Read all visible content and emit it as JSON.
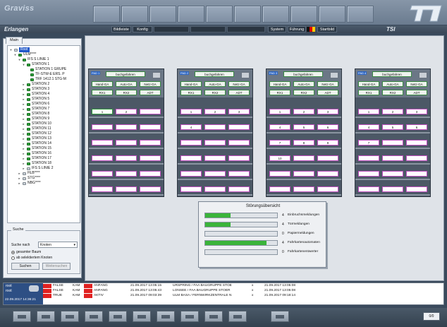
{
  "header": {
    "app_title": "Graviss",
    "location": "Erlangen",
    "brand": "TSI"
  },
  "nav": {
    "bildleiste": "Bildleiste",
    "konfig": "Konfig",
    "system": "System",
    "fuehrung": "Führung",
    "startbild": "Startbild"
  },
  "tabs": {
    "main": "Main"
  },
  "tree": {
    "root": "Root",
    "ulm": "ULM****",
    "ifs_linie_1": "IFS S LINIE 1",
    "station_1": "STATION 1",
    "station_1_grupe": "STATION 1 GRUPE",
    "tf_stw": "TF-STW-E ERS. P",
    "trf": "TRF 1412.1 STG-M",
    "stations": [
      "STATION 2",
      "STATION 3",
      "STATION 4",
      "STATION 5",
      "STATION 6",
      "STATION 7",
      "STATION 8",
      "STATION 9",
      "STATION 10",
      "STATION 11",
      "STATION 12",
      "STATION 13",
      "STATION 14",
      "STATION 15",
      "STATION 16",
      "STATION 17",
      "STATION 18"
    ],
    "ifs_linie_2": "IFS S LINIE 2",
    "hlb": "HLB****",
    "stg": "STG****",
    "nbg": "NBG****"
  },
  "search": {
    "title": "Suche",
    "label": "Suche nach",
    "selected": "Knoten",
    "radio_1": "gesamter Baum",
    "radio_2": "ab selektiertem Knoten",
    "btn_search": "Suchen",
    "btn_next": "Weitersuchen"
  },
  "racks": [
    {
      "hdr": "PAD 1",
      "title": "buchgefahren",
      "b1": "Hand-GA",
      "b2": "Auto-GA",
      "b3": "Netz-GA",
      "c1": "RX1",
      "c2": "RX2",
      "c3": "ADT",
      "slots": [
        [
          "1",
          "2",
          ""
        ],
        [
          "",
          "",
          ""
        ],
        [
          "",
          "",
          ""
        ],
        [
          "",
          "",
          ""
        ],
        [
          "",
          "",
          ""
        ],
        [
          "",
          "",
          ""
        ]
      ]
    },
    {
      "hdr": "PAD 2",
      "title": "buchgefahren",
      "b1": "Hand-GA",
      "b2": "Auto-GA",
      "b3": "Netz-GA",
      "c1": "RX1",
      "c2": "RX2",
      "c3": "ADT",
      "slots": [
        [
          "1",
          "2",
          "3"
        ],
        [
          "4",
          "",
          ""
        ],
        [
          "",
          "",
          ""
        ],
        [
          "",
          "",
          ""
        ],
        [
          "",
          "",
          ""
        ],
        [
          "",
          "",
          ""
        ]
      ]
    },
    {
      "hdr": "PAD 3",
      "title": "buchgefahren",
      "b1": "Hand-GA",
      "b2": "Auto-GA",
      "b3": "Netz-GA",
      "c1": "RX1",
      "c2": "RX2",
      "c3": "ADT",
      "slots": [
        [
          "1",
          "2",
          "3"
        ],
        [
          "4",
          "5",
          "6"
        ],
        [
          "7",
          "8",
          "9"
        ],
        [
          "10",
          "",
          ""
        ],
        [
          "",
          "",
          ""
        ],
        [
          "",
          "",
          ""
        ]
      ]
    },
    {
      "hdr": "PAD 4",
      "title": "buchgefahren",
      "b1": "Hand-GA",
      "b2": "Auto-GA",
      "b3": "Netz-GA",
      "c1": "RX1",
      "c2": "RX2",
      "c3": "ADT",
      "slots": [
        [
          "1",
          "2",
          "3"
        ],
        [
          "4",
          "5",
          "6"
        ],
        [
          "7",
          "",
          ""
        ],
        [
          "",
          "",
          ""
        ],
        [
          "",
          "",
          ""
        ],
        [
          "",
          "",
          ""
        ]
      ]
    }
  ],
  "summary": {
    "title": "Störungsübersicht",
    "rows": [
      {
        "value": "4",
        "label": "Einbruchsmeldungen",
        "fill": 0.35
      },
      {
        "value": "4",
        "label": "Türmeldungen",
        "fill": 0.35
      },
      {
        "value": "0",
        "label": "Papiermeldungen",
        "fill": 0
      },
      {
        "value": "4",
        "label": "Fahrkartenautomaten",
        "fill": 0.85
      },
      {
        "value": "0",
        "label": "Fahrkartenentwerter",
        "fill": 0
      }
    ]
  },
  "log": {
    "user": "root",
    "user2": "root",
    "datetime": "22.09.2017 14:36:21",
    "rows": [
      {
        "flag": "FALSE",
        "type": "KAM",
        "state": "ANFANG",
        "time": "21.09.2017 13:05:15",
        "text": "URSPRING / FAA BAUGRUPPE STOE",
        "x": "x",
        "time2": "21.09.2017 13:05:08"
      },
      {
        "flag": "FALSE",
        "type": "KAM",
        "state": "ANFANG",
        "time": "21.09.2017 13:05:43",
        "text": "LONSEE / FAA BAUGRUPPE STOER",
        "x": "x",
        "time2": "21.09.2017 13:05:08"
      },
      {
        "flag": "TRUE",
        "type": "KAM",
        "state": "AKTIV",
        "time": "21.09.2017 09:03:39",
        "text": "ULM BASA / FERNWIRKZENTRALE N",
        "x": "x",
        "time2": "21.09.2017 09:18:14"
      }
    ]
  },
  "taskbar": {
    "page": "0/0"
  },
  "colors": {
    "accent": "#2e67c4",
    "ok": "#3ab43a",
    "alarm": "#e02020",
    "slot_border": "#c050c0"
  }
}
